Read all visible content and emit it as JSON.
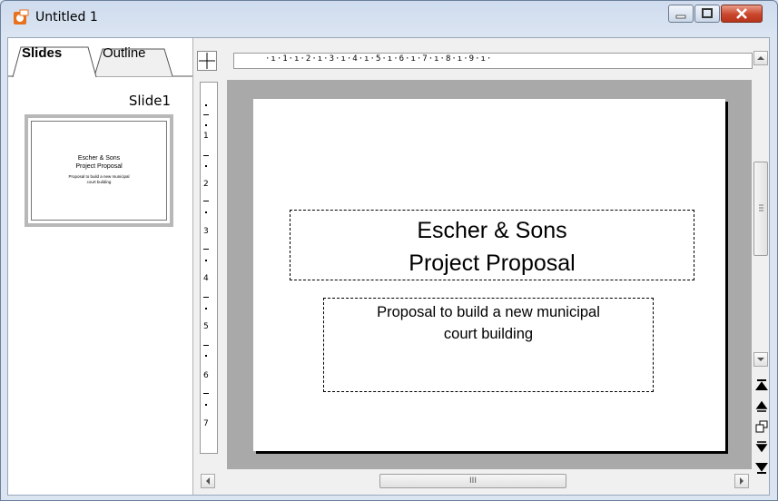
{
  "window": {
    "title": "Untitled 1"
  },
  "tabs": [
    {
      "label": "Slides"
    },
    {
      "label": "Outline"
    }
  ],
  "slide_pane": {
    "slide_label": "Slide1"
  },
  "ruler": {
    "horizontal_text": "·ı·1·ı·2·ı·3·ı·4·ı·5·ı·6·ı·7·ı·8·ı·9·ı·",
    "vertical_numbers": [
      "1",
      "2",
      "3",
      "4",
      "5",
      "6",
      "7"
    ]
  },
  "slide": {
    "title_line1": "Escher & Sons",
    "title_line2": "Project Proposal",
    "subtitle_line1": "Proposal to build a new municipal",
    "subtitle_line2": "court building"
  },
  "nav_icons": [
    "first-slide-icon",
    "previous-slide-icon",
    "navigator-icon",
    "next-slide-icon",
    "last-slide-icon"
  ],
  "scrollbar": {
    "hthumb_grip": "III"
  },
  "colors": {
    "canvas": "#a9a9a9",
    "titlebar": "#cfdcee",
    "close_button": "#c9462c",
    "app_icon": "#e8711e"
  }
}
